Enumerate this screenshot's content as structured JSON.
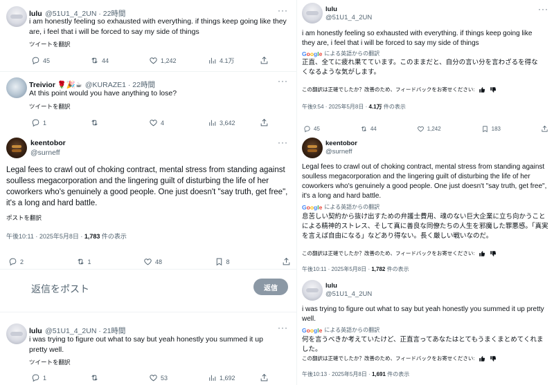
{
  "left": {
    "tweet1": {
      "name": "lulu",
      "handle": "@51U1_4_2UN · 22時間",
      "text": "i am honestly feeling so exhausted with everything. if things keep going like they are, i feel that i will be forced to say my side of things",
      "translate": "ツイートを翻訳",
      "replies": "45",
      "retweets": "44",
      "likes": "1,242",
      "views": "4.1万"
    },
    "tweet2": {
      "name": "Treivior 🌹🎉☕",
      "handle": "@KURAZE1 · 22時間",
      "text": "At this point would you have anything to lose?",
      "translate": "ツイートを翻訳",
      "replies": "1",
      "retweets": "",
      "likes": "4",
      "views": "3,642"
    },
    "main": {
      "name": "keentobor",
      "handle": "@surneff",
      "text": "Legal fees to crawl out of choking contract, mental stress from standing against soulless megacorporation and the lingering guilt of disturbing the life of her coworkers who's genuinely a good people. One just doesn't \"say truth, get free\", it's a long and hard battle.",
      "translate": "ポストを翻訳",
      "time": "午後10:11 · 2025年5月8日 · ",
      "views_num": "1,783",
      "views_label": " 件の表示",
      "replies": "2",
      "retweets": "1",
      "likes": "48",
      "bookmarks": "8"
    },
    "reply_box": {
      "placeholder": "返信をポスト",
      "button": "返信"
    },
    "tweet3": {
      "name": "lulu",
      "handle": "@51U1_4_2UN · 21時間",
      "text": "i was trying to figure out what to say but yeah honestly you summed it up pretty well.",
      "translate": "ツイートを翻訳",
      "replies": "1",
      "retweets": "",
      "likes": "53",
      "views": "1,692"
    }
  },
  "right": {
    "t1": {
      "name": "lulu",
      "handle": "@51U1_4_2UN",
      "text": "i am honestly feeling so exhausted with everything. if things keep going like they are, i feel that i will be forced to say my side of things",
      "google": "Google",
      "google_suffix": "による英語からの翻訳",
      "jp": "正直、全てに疲れ果てています。このままだと、自分の言い分を言わざるを得なくなるような気がします。",
      "feedback": "この翻訳は正確でしたか？改善のため、フィードバックをお寄せください:",
      "time": "午後9:54 · 2025年5月8日 · ",
      "views_num": "4.1万",
      "views_label": " 件の表示",
      "replies": "45",
      "retweets": "44",
      "likes": "1,242",
      "bookmarks": "183"
    },
    "t2": {
      "name": "keentobor",
      "handle": "@surneff",
      "text": "Legal fees to crawl out of choking contract, mental stress from standing against soulless megacorporation and the lingering guilt of disturbing the life of her coworkers who's genuinely a good people. One just doesn't \"say truth, get free\", it's a long and hard battle.",
      "google": "Google",
      "google_suffix": "による英語からの翻訳",
      "jp": "息苦しい契約から抜け出すための弁護士費用、魂のない巨大企業に立ち向かうことによる精神的ストレス、そして真に善良な同僚たちの人生を邪魔した罪悪感。「真実を言えば自由になる」などあり得ない。長く厳しい戦いなのだ。",
      "feedback": "この翻訳は正確でしたか？改善のため、フィードバックをお寄せください:",
      "time": "午後10:11 · 2025年5月8日 · ",
      "views_num": "1,782",
      "views_label": " 件の表示"
    },
    "t3": {
      "name": "lulu",
      "handle": "@51U1_4_2UN",
      "text": "i was trying to figure out what to say but yeah honestly you summed it up pretty well.",
      "google": "Google",
      "google_suffix": "による英語からの翻訳",
      "jp": "何を言うべきか考えていたけど、正直言ってあなたはとてもうまくまとめてくれました。",
      "feedback": "この翻訳は正確でしたか？改善のため、フィードバックをお寄せください:",
      "time": "午後10:13 · 2025年5月8日 · ",
      "views_num": "1,691",
      "views_label": " 件の表示"
    }
  },
  "icons": {
    "reply": "reply-icon",
    "retweet": "retweet-icon",
    "like": "like-icon",
    "views": "views-icon",
    "bookmark": "bookmark-icon",
    "share": "share-icon",
    "more": "more-icon",
    "thumbs_up": "thumbs-up-icon",
    "thumbs_down": "thumbs-down-icon"
  },
  "colors": {
    "muted": "#536471",
    "text": "#0f1419",
    "divider": "#eff3f4",
    "reply_button": "#8b98a5"
  }
}
